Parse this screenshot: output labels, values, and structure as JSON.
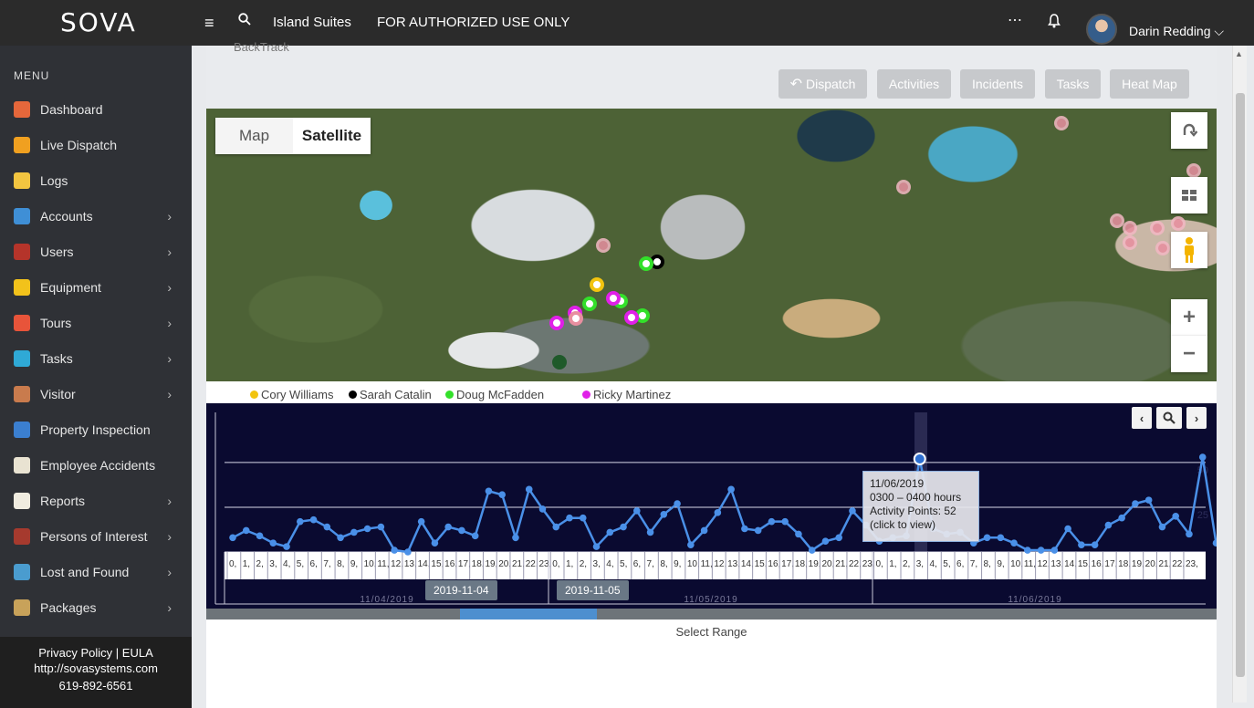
{
  "topbar": {
    "logo": "SOVA",
    "site_name": "Island Suites",
    "auth_notice": "FOR AUTHORIZED USE ONLY",
    "user_name": "Darin Redding",
    "user_caret": "⌵",
    "more_icon": "⋯",
    "menu_icon": "≡"
  },
  "sidebar": {
    "title": "MENU",
    "items": [
      {
        "label": "Dashboard",
        "icon": "home-icon",
        "color": "#e5673b",
        "expandable": false
      },
      {
        "label": "Live Dispatch",
        "icon": "shield-icon",
        "color": "#f0a020",
        "expandable": false
      },
      {
        "label": "Logs",
        "icon": "pencil-icon",
        "color": "#f3c540",
        "expandable": false
      },
      {
        "label": "Accounts",
        "icon": "building-icon",
        "color": "#3f8fd6",
        "expandable": true
      },
      {
        "label": "Users",
        "icon": "person-icon",
        "color": "#b5342a",
        "expandable": true
      },
      {
        "label": "Equipment",
        "icon": "hardhat-icon",
        "color": "#f2c21b",
        "expandable": true
      },
      {
        "label": "Tours",
        "icon": "compass-icon",
        "color": "#e8543a",
        "expandable": true
      },
      {
        "label": "Tasks",
        "icon": "gear-icon",
        "color": "#2fa9d6",
        "expandable": true
      },
      {
        "label": "Visitor",
        "icon": "visitor-icon",
        "color": "#c97b4d",
        "expandable": true
      },
      {
        "label": "Property Inspection",
        "icon": "house-check-icon",
        "color": "#3b7fd0",
        "expandable": false
      },
      {
        "label": "Employee Accidents",
        "icon": "clipboard-icon",
        "color": "#e9e3d2",
        "expandable": false
      },
      {
        "label": "Reports",
        "icon": "report-icon",
        "color": "#f0ece0",
        "expandable": true
      },
      {
        "label": "Persons of Interest",
        "icon": "suspect-icon",
        "color": "#a63a2e",
        "expandable": true
      },
      {
        "label": "Lost and Found",
        "icon": "target-icon",
        "color": "#4a9ccf",
        "expandable": true
      },
      {
        "label": "Packages",
        "icon": "package-icon",
        "color": "#c8a25a",
        "expandable": true
      }
    ],
    "footer": {
      "privacy": "Privacy Policy",
      "separator": "|",
      "eula": "EULA",
      "url": "http://sovasystems.com",
      "phone": "619-892-6561"
    }
  },
  "header": {
    "breadcrumb": "BackTrack",
    "buttons": [
      "Dispatch",
      "Activities",
      "Incidents",
      "Tasks",
      "Heat Map"
    ],
    "dispatch_icon": "↶"
  },
  "map": {
    "toggle": {
      "map": "Map",
      "satellite": "Satellite",
      "selected": "Satellite"
    },
    "controls": [
      "rotate-icon",
      "tilt-icon",
      "pegman-icon",
      "zoom-in-icon",
      "zoom-out-icon"
    ],
    "zoom_in": "+",
    "zoom_out": "−"
  },
  "legend": [
    {
      "name": "Cory Williams",
      "color": "#f2c40f"
    },
    {
      "name": "Sarah Catalin",
      "color": "#000000"
    },
    {
      "name": "Doug McFadden",
      "color": "#33e02a"
    },
    {
      "name": "Ricky Martinez",
      "color": "#e020e8"
    }
  ],
  "timeline": {
    "nav": {
      "prev": "‹",
      "zoom": "search-icon",
      "next": "›"
    },
    "y_ticks": [
      "50",
      "25"
    ],
    "day_labels": [
      "11/04/2019",
      "11/05/2019",
      "11/06/2019"
    ],
    "range_flags": [
      "2019-11-04",
      "2019-11-05"
    ],
    "tooltip": {
      "date": "11/06/2019",
      "hours": "0300 – 0400 hours",
      "points": "Activity Points: 52",
      "action": "(click to view)"
    },
    "select_range": "Select Range"
  },
  "chart_data": {
    "type": "line",
    "title": "",
    "ylabel": "",
    "ylim": [
      0,
      60
    ],
    "hour_labels": [
      "0",
      "1",
      "2",
      "3",
      "4",
      "5",
      "6",
      "7",
      "8",
      "9",
      "10",
      "11",
      "12",
      "13",
      "14",
      "15",
      "16",
      "17",
      "18",
      "19",
      "20",
      "21",
      "22",
      "23",
      "0",
      "1",
      "2",
      "3",
      "4",
      "5",
      "6",
      "7",
      "8",
      "9",
      "10",
      "11",
      "12",
      "13",
      "14",
      "15",
      "16",
      "17",
      "18",
      "19",
      "20",
      "21",
      "22",
      "23",
      "0",
      "1",
      "2",
      "3",
      "4",
      "5",
      "6",
      "7",
      "8",
      "9",
      "10",
      "11",
      "12",
      "13",
      "14",
      "15",
      "16",
      "17",
      "18",
      "19",
      "20",
      "21",
      "22",
      "23"
    ],
    "series": [
      {
        "color": "#4a90e8",
        "values": [
          8,
          12,
          9,
          5,
          3,
          17,
          18,
          14,
          8,
          11,
          13,
          14,
          1,
          0,
          17,
          5,
          14,
          12,
          9,
          34,
          32,
          8,
          35,
          24,
          14,
          19,
          19,
          3,
          11,
          14,
          23,
          11,
          21,
          27,
          4,
          12,
          22,
          35,
          13,
          12,
          17,
          17,
          10,
          1,
          6,
          8,
          23,
          15,
          6,
          8,
          9,
          52,
          13,
          10,
          11,
          5,
          8,
          8,
          5,
          1,
          1,
          1,
          13,
          4,
          4,
          15,
          19,
          27,
          29,
          14,
          20,
          10,
          53,
          5
        ]
      }
    ]
  }
}
